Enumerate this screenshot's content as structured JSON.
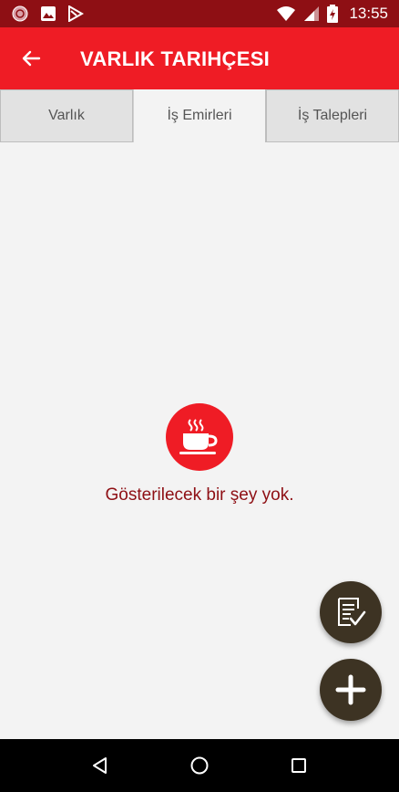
{
  "status_bar": {
    "time": "13:55",
    "left_icons": [
      "app-notification-icon",
      "image-icon",
      "play-store-icon"
    ],
    "right_icons": [
      "wifi-icon",
      "signal-icon",
      "battery-charging-icon"
    ],
    "background": "#8e0f14"
  },
  "app_bar": {
    "title": "VARLIK TARIHÇESI",
    "back_icon": "arrow-left-icon",
    "background": "#ef1c25"
  },
  "tabs": [
    {
      "label": "Varlık",
      "active": false
    },
    {
      "label": "İş Emirleri",
      "active": true
    },
    {
      "label": "İş Talepleri",
      "active": false
    }
  ],
  "empty_state": {
    "icon": "coffee-cup-icon",
    "message": "Gösterilecek bir şey yok.",
    "icon_color": "#ef1c25",
    "text_color": "#8e0f14"
  },
  "fabs": [
    {
      "icon": "checklist-icon",
      "color": "#3d3323"
    },
    {
      "icon": "plus-icon",
      "color": "#3d3323"
    }
  ],
  "nav_bar": {
    "buttons": [
      "nav-back-icon",
      "nav-home-icon",
      "nav-recent-icon"
    ]
  }
}
